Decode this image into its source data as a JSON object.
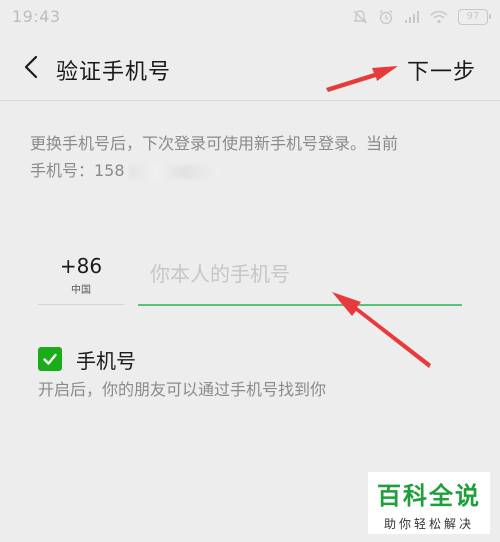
{
  "status_bar": {
    "time": "19:43",
    "battery": "97",
    "icons": [
      "mute-bell-icon",
      "alarm-icon",
      "signal-icon",
      "wifi-icon",
      "battery-icon"
    ]
  },
  "header": {
    "back_icon": "chevron-left-icon",
    "title": "验证手机号",
    "next_label": "下一步"
  },
  "description": {
    "line1": "更换手机号后，下次登录可使用新手机号登录。当前",
    "line2_prefix": "手机号：158"
  },
  "form": {
    "country_code": "+86",
    "country_name": "中国",
    "phone_placeholder": "你本人的手机号",
    "phone_value": ""
  },
  "option": {
    "label": "手机号",
    "checked": true,
    "hint": "开启后，你的朋友可以通过手机号找到你"
  },
  "watermark": {
    "title": "百科全说",
    "subtitle": "助你轻松解决"
  },
  "colors": {
    "accent_green": "#1aad19",
    "underline_green": "#59c17c",
    "arrow_red": "#e83a3a",
    "background": "#ededed"
  }
}
